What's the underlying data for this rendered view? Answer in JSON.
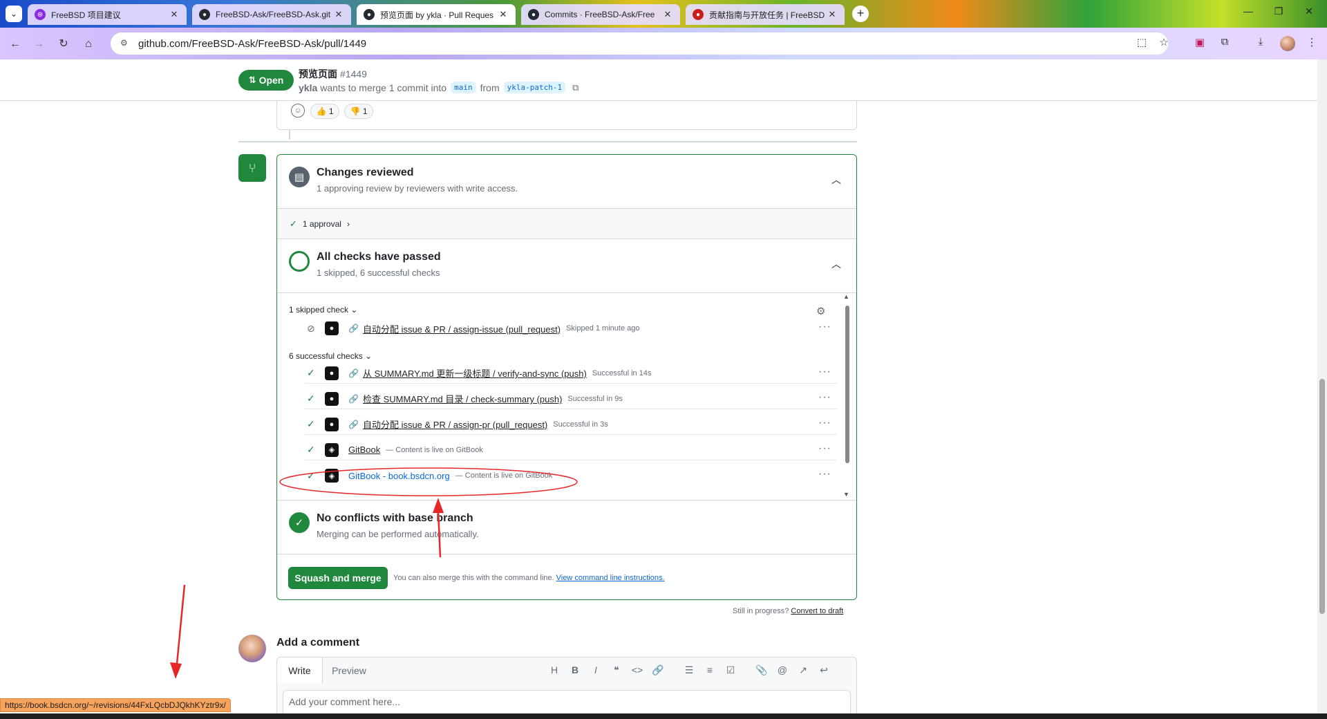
{
  "browser": {
    "tabs": [
      {
        "title": "FreeBSD 项目建议",
        "active": false
      },
      {
        "title": "FreeBSD-Ask/FreeBSD-Ask.git",
        "active": false
      },
      {
        "title": "预览页面 by ykla · Pull Reques",
        "active": true
      },
      {
        "title": "Commits · FreeBSD-Ask/Free",
        "active": false
      },
      {
        "title": "贡献指南与开放任务 | FreeBSD",
        "active": false
      }
    ],
    "url": "github.com/FreeBSD-Ask/FreeBSD-Ask/pull/1449",
    "status_url": "https://book.bsdcn.org/~/revisions/44FxLQcbDJQkhKYztr9x/"
  },
  "pr": {
    "state_label": "Open",
    "title": "预览页面",
    "number": "#1449",
    "author": "ykla",
    "summary_text": "wants to merge 1 commit into",
    "base_branch": "main",
    "from_text": "from",
    "head_branch": "ykla-patch-1"
  },
  "reactions": [
    {
      "emoji": "👍",
      "count": "1"
    },
    {
      "emoji": "👎",
      "count": "1"
    }
  ],
  "merge_box": {
    "review": {
      "title": "Changes reviewed",
      "subtitle": "1 approving review by reviewers with write access.",
      "approval_label": "1 approval"
    },
    "checks": {
      "title": "All checks have passed",
      "subtitle": "1 skipped, 6 successful checks",
      "skipped_group_label": "1 skipped check",
      "success_group_label": "6 successful checks",
      "skipped": [
        {
          "name": "自动分配 issue & PR / assign-issue (pull_request)",
          "meta": "Skipped 1 minute ago"
        }
      ],
      "successful": [
        {
          "name": "从 SUMMARY.md 更新一级标题 / verify-and-sync (push)",
          "meta": "Successful in 14s"
        },
        {
          "name": "检查 SUMMARY.md 目录 / check-summary (push)",
          "meta": "Successful in 9s"
        },
        {
          "name": "自动分配 issue & PR / assign-pr (pull_request)",
          "meta": "Successful in 3s"
        },
        {
          "name": "GitBook",
          "meta": "— Content is live on GitBook"
        },
        {
          "name": "GitBook - book.bsdcn.org",
          "meta": "— Content is live on GitBook"
        }
      ]
    },
    "conflicts": {
      "title": "No conflicts with base branch",
      "subtitle": "Merging can be performed automatically."
    },
    "merge_button": "Squash and merge",
    "merge_note": "You can also merge this with the command line.",
    "merge_note_link": "View command line instructions."
  },
  "draft": {
    "text": "Still in progress?",
    "link": "Convert to draft"
  },
  "comment": {
    "heading": "Add a comment",
    "tab_write": "Write",
    "tab_preview": "Preview",
    "placeholder": "Add your comment here..."
  },
  "colors": {
    "success_green": "#1f883d",
    "link_blue": "#0969da",
    "annotation_red": "#e8262a"
  }
}
